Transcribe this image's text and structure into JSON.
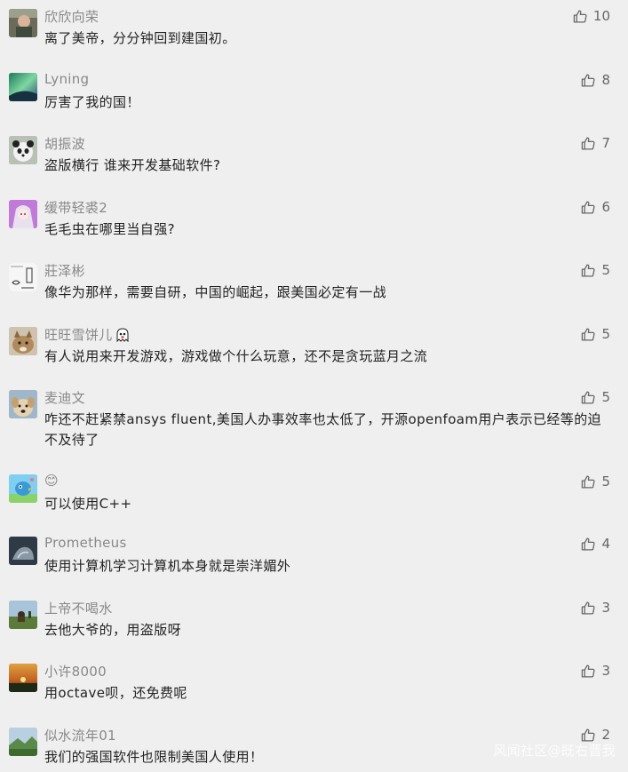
{
  "comments": [
    {
      "nickname": "欣欣向荣",
      "text": "离了美帝，分分钟回到建国初。",
      "likes": "10",
      "avatar": "avatar-portrait-icon"
    },
    {
      "nickname": "Lyning",
      "text": "厉害了我的国！",
      "likes": "8",
      "avatar": "avatar-aurora-icon"
    },
    {
      "nickname": "胡振波",
      "text": "盗版横行 谁来开发基础软件?",
      "likes": "7",
      "avatar": "avatar-panda-icon"
    },
    {
      "nickname": "缓带轻裘2",
      "text": "毛毛虫在哪里当自强?",
      "likes": "6",
      "avatar": "avatar-anime-icon"
    },
    {
      "nickname": "莊泽彬",
      "text": "像华为那样，需要自研，中国的崛起，跟美国必定有一战",
      "likes": "5",
      "avatar": "avatar-sketch-icon"
    },
    {
      "nickname": "旺旺雪饼儿",
      "text": "有人说用来开发游戏，游戏做个什么玩意，还不是贪玩蓝月之流",
      "likes": "5",
      "avatar": "avatar-cat-icon",
      "badge": "ghost-emoji-icon"
    },
    {
      "nickname": "麦迪文",
      "text": "咋还不赶紧禁ansys fluent,美国人办事效率也太低了，开源openfoam用户表示已经等的迫不及待了",
      "likes": "5",
      "avatar": "avatar-dog-icon"
    },
    {
      "nickname": "😊",
      "text": "可以使用C++",
      "likes": "5",
      "avatar": "avatar-bird-icon"
    },
    {
      "nickname": "Prometheus",
      "text": "使用计算机学习计算机本身就是崇洋媚外",
      "likes": "4",
      "avatar": "avatar-dark-icon"
    },
    {
      "nickname": "上帝不喝水",
      "text": "去他大爷的，用盗版呀",
      "likes": "3",
      "avatar": "avatar-field-icon"
    },
    {
      "nickname": "小许8000",
      "text": "用octave呗，还免费呢",
      "likes": "3",
      "avatar": "avatar-sunset-icon"
    },
    {
      "nickname": "似水流年01",
      "text": "我们的强国软件也限制美国人使用！",
      "likes": "2",
      "avatar": "avatar-landscape-icon"
    }
  ],
  "watermark": "风闻社区@既右晋我",
  "colors": {
    "background": "#efefef",
    "nickname": "#888888",
    "text": "#222222",
    "like": "#666666"
  }
}
